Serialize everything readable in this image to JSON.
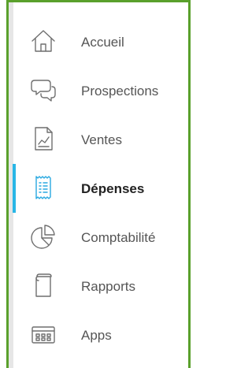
{
  "sidebar": {
    "items": [
      {
        "label": "Accueil",
        "icon": "home-icon",
        "active": false
      },
      {
        "label": "Prospections",
        "icon": "chat-bubbles-icon",
        "active": false
      },
      {
        "label": "Ventes",
        "icon": "sales-chart-icon",
        "active": false
      },
      {
        "label": "Dépenses",
        "icon": "receipt-icon",
        "active": true
      },
      {
        "label": "Comptabilité",
        "icon": "pie-chart-icon",
        "active": false
      },
      {
        "label": "Rapports",
        "icon": "report-icon",
        "active": false
      },
      {
        "label": "Apps",
        "icon": "apps-grid-icon",
        "active": false
      }
    ]
  },
  "colors": {
    "frame_border": "#5aa02c",
    "active_indicator": "#29b6e6",
    "active_icon": "#29a9e1",
    "text": "#555555",
    "active_text": "#222222"
  }
}
